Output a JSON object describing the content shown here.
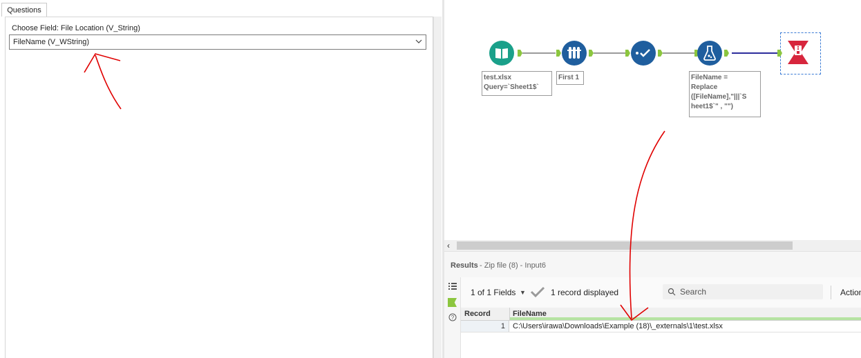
{
  "config_panel": {
    "tab_label": "Questions",
    "field_label": "Choose Field: File Location (V_String)",
    "selected_field": "FileName (V_WString)"
  },
  "workflow": {
    "tools": [
      {
        "name": "input-tool",
        "icon": "book-icon",
        "color": "#1aa08a"
      },
      {
        "name": "sample-tool",
        "icon": "test-tubes-icon",
        "color": "#1f5e9e"
      },
      {
        "name": "select-tool",
        "icon": "checkmark-flow-icon",
        "color": "#1f5e9e"
      },
      {
        "name": "formula-tool",
        "icon": "flask-icon",
        "color": "#1f5e9e"
      },
      {
        "name": "output-tool",
        "icon": "zip-file-icon",
        "color": "#d7263d"
      }
    ],
    "annotations": {
      "input": "test.xlsx\nQuery=`Sheet1$`",
      "sample": "First 1",
      "formula": "FileName =\nReplace\n([FileName],\"|||`S\nheet1$`\" , \"\")"
    }
  },
  "results": {
    "title": "Results",
    "subtitle": "- Zip file (8) - Input6",
    "fields_selector": "1 of 1 Fields",
    "records_displayed": "1 record displayed",
    "search_placeholder": "Search",
    "actions_label": "Action",
    "columns": [
      "Record",
      "FileName"
    ],
    "rows": [
      {
        "record": "1",
        "filename": "C:\\Users\\irawa\\Downloads\\Example (18)\\_externals\\1\\test.xlsx"
      }
    ]
  },
  "colors": {
    "accent_green": "#8cc63f",
    "annotation_red": "#e00000",
    "connection_blue": "#2c2c9c"
  }
}
